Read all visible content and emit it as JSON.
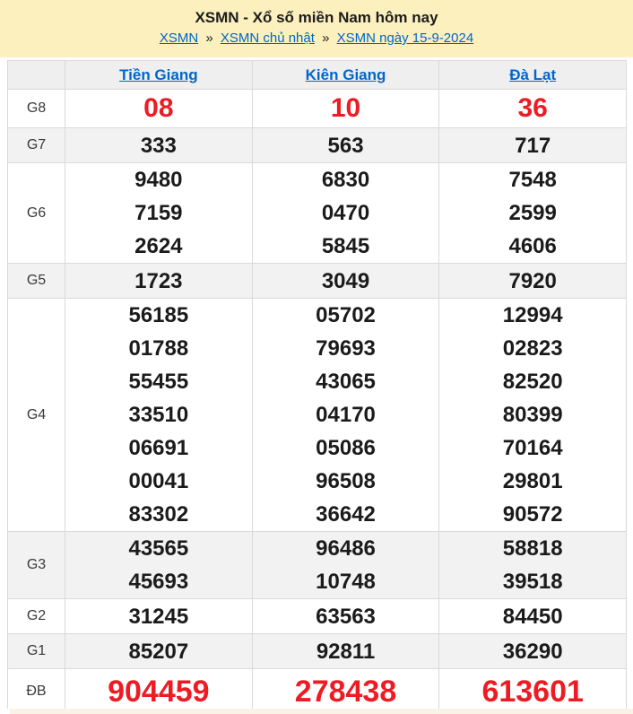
{
  "header": {
    "title": "XSMN - Xổ số miền Nam hôm nay",
    "separator": "»",
    "breadcrumb": [
      {
        "label": "XSMN"
      },
      {
        "label": "XSMN chủ nhật"
      },
      {
        "label": "XSMN ngày 15-9-2024"
      }
    ]
  },
  "table": {
    "columns": [
      "Tiền Giang",
      "Kiên Giang",
      "Đà Lạt"
    ],
    "rows": [
      {
        "prize": "G8",
        "type": "g8",
        "values": [
          [
            "08"
          ],
          [
            "10"
          ],
          [
            "36"
          ]
        ]
      },
      {
        "prize": "G7",
        "type": "",
        "values": [
          [
            "333"
          ],
          [
            "563"
          ],
          [
            "717"
          ]
        ]
      },
      {
        "prize": "G6",
        "type": "",
        "values": [
          [
            "9480",
            "7159",
            "2624"
          ],
          [
            "6830",
            "0470",
            "5845"
          ],
          [
            "7548",
            "2599",
            "4606"
          ]
        ]
      },
      {
        "prize": "G5",
        "type": "",
        "values": [
          [
            "1723"
          ],
          [
            "3049"
          ],
          [
            "7920"
          ]
        ]
      },
      {
        "prize": "G4",
        "type": "",
        "values": [
          [
            "56185",
            "01788",
            "55455",
            "33510",
            "06691",
            "00041",
            "83302"
          ],
          [
            "05702",
            "79693",
            "43065",
            "04170",
            "05086",
            "96508",
            "36642"
          ],
          [
            "12994",
            "02823",
            "82520",
            "80399",
            "70164",
            "29801",
            "90572"
          ]
        ]
      },
      {
        "prize": "G3",
        "type": "",
        "values": [
          [
            "43565",
            "45693"
          ],
          [
            "96486",
            "10748"
          ],
          [
            "58818",
            "39518"
          ]
        ]
      },
      {
        "prize": "G2",
        "type": "",
        "values": [
          [
            "31245"
          ],
          [
            "63563"
          ],
          [
            "84450"
          ]
        ]
      },
      {
        "prize": "G1",
        "type": "",
        "values": [
          [
            "85207"
          ],
          [
            "92811"
          ],
          [
            "36290"
          ]
        ]
      },
      {
        "prize": "ĐB",
        "type": "db",
        "values": [
          [
            "904459"
          ],
          [
            "278438"
          ],
          [
            "613601"
          ]
        ]
      }
    ]
  },
  "colors": {
    "header_band": "#fcf0be",
    "link_blue": "#0066cc",
    "highlight_red": "#ed1c24",
    "row_stripe": "#f2f2f2"
  }
}
